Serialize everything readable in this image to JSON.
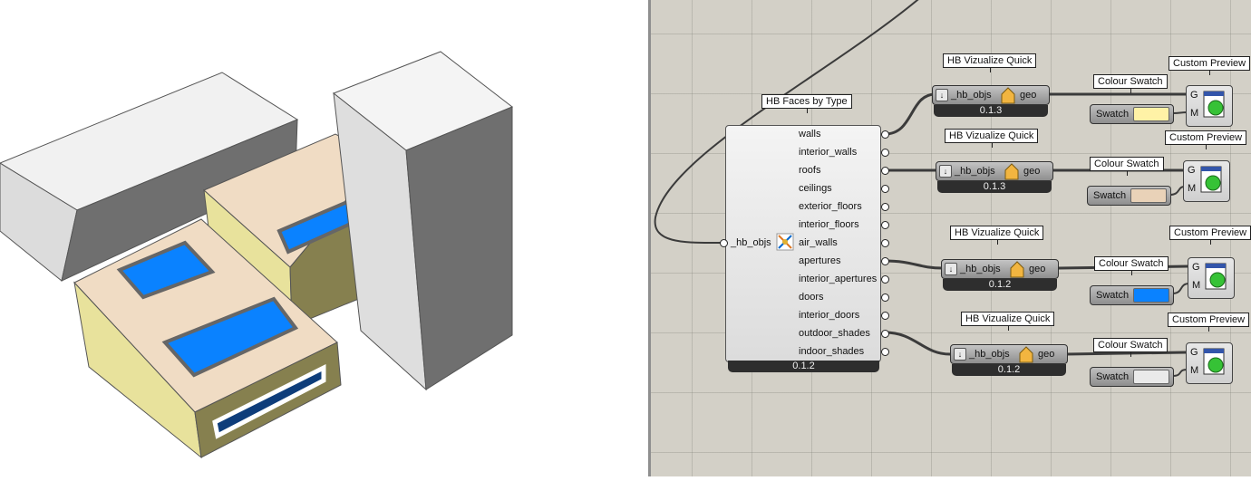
{
  "colors": {
    "canvas_bg": "#d3d0c7",
    "wall_tan": "#f0dcc4",
    "wall_yellow": "#e9e3a0",
    "wall_olive": "#86804f",
    "aperture_blue": "#0a82ff",
    "door_navy": "#0e3d7a",
    "shade_gray": "#ececec"
  },
  "hb_faces": {
    "tag": "HB Faces by Type",
    "input": "_hb_objs",
    "icon": "faces-by-type-icon",
    "outputs": [
      "walls",
      "interior_walls",
      "roofs",
      "ceilings",
      "exterior_floors",
      "interior_floors",
      "air_walls",
      "apertures",
      "interior_apertures",
      "doors",
      "interior_doors",
      "outdoor_shades",
      "indoor_shades"
    ],
    "version": "0.1.2"
  },
  "viz": [
    {
      "tag": "HB Vizualize Quick",
      "input": "_hb_objs",
      "output": "geo",
      "version": "0.1.3"
    },
    {
      "tag": "HB Vizualize Quick",
      "input": "_hb_objs",
      "output": "geo",
      "version": "0.1.3"
    },
    {
      "tag": "HB Vizualize Quick",
      "input": "_hb_objs",
      "output": "geo",
      "version": "0.1.2"
    },
    {
      "tag": "HB Vizualize Quick",
      "input": "_hb_objs",
      "output": "geo",
      "version": "0.1.2"
    }
  ],
  "swatches": [
    {
      "tag": "Colour Swatch",
      "label": "Swatch",
      "color": "#fff2a6"
    },
    {
      "tag": "Colour Swatch",
      "label": "Swatch",
      "color": "#e9d2b8"
    },
    {
      "tag": "Colour Swatch",
      "label": "Swatch",
      "color": "#0a82ff"
    },
    {
      "tag": "Colour Swatch",
      "label": "Swatch",
      "color": "#eaeaea"
    }
  ],
  "previews": [
    {
      "tag": "Custom Preview",
      "in_g": "G",
      "in_m": "M"
    },
    {
      "tag": "Custom Preview",
      "in_g": "G",
      "in_m": "M"
    },
    {
      "tag": "Custom Preview",
      "in_g": "G",
      "in_m": "M"
    },
    {
      "tag": "Custom Preview",
      "in_g": "G",
      "in_m": "M"
    }
  ]
}
